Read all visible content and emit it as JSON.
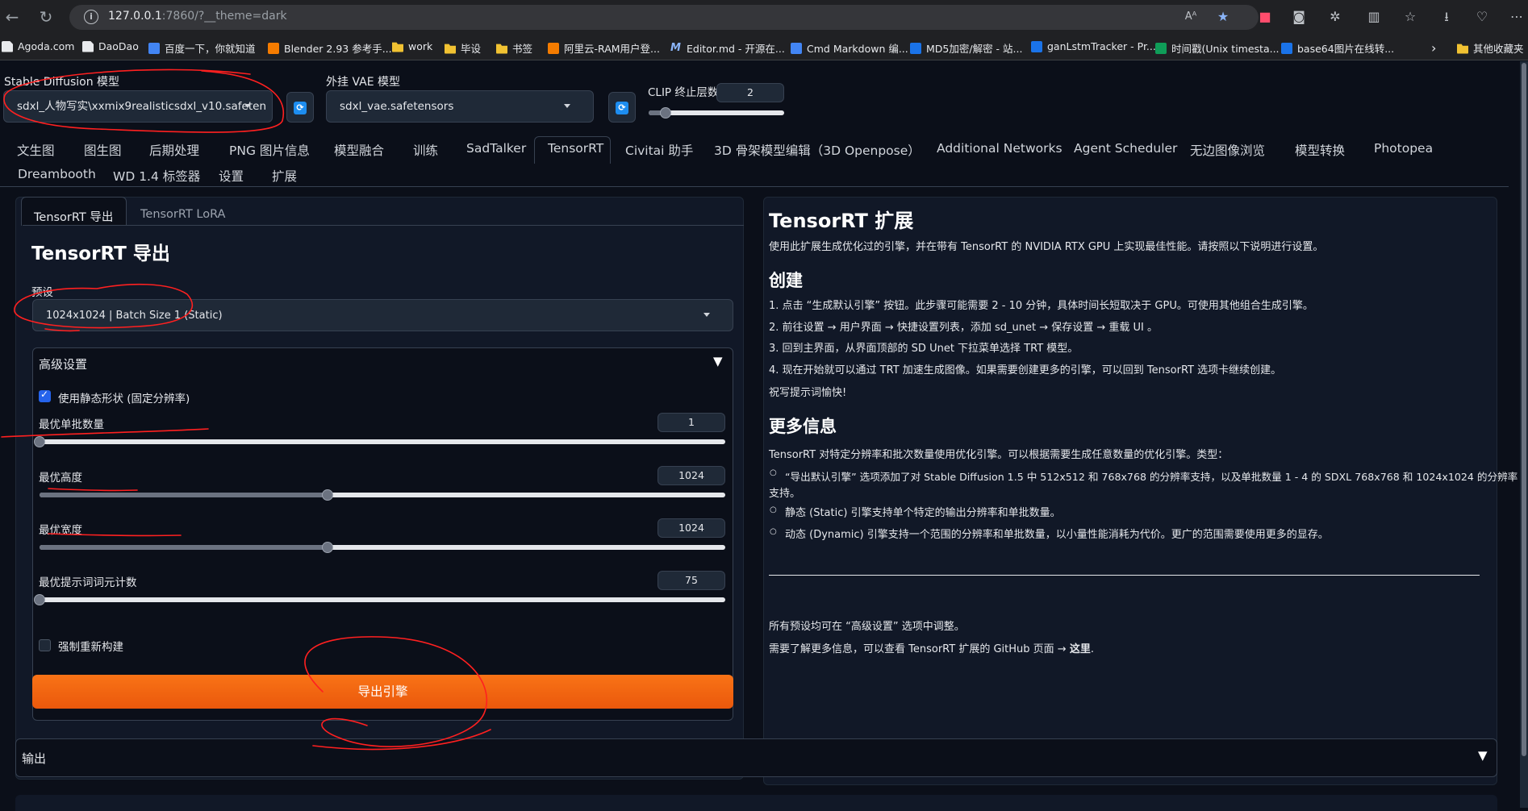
{
  "browser": {
    "url_host": "127.0.0.1",
    "url_rest": ":7860/?__theme=dark",
    "bookmarks": [
      "Agoda.com",
      "DaoDao",
      "百度一下，你就知道",
      "Blender 2.93 参考手...",
      "work",
      "毕设",
      "书签",
      "阿里云-RAM用户登...",
      "Editor.md - 开源在...",
      "Cmd Markdown 编...",
      "MD5加密/解密 - 站...",
      "ganLstmTracker - Pr...",
      "时间戳(Unix timesta...",
      "base64图片在线转...",
      "其他收藏夹"
    ]
  },
  "header": {
    "sd_model_label": "Stable Diffusion 模型",
    "sd_model_value": "sdxl_人物写实\\xxmix9realisticsdxl_v10.safeten",
    "vae_label": "外挂 VAE 模型",
    "vae_value": "sdxl_vae.safetensors",
    "clip_label": "CLIP 终止层数",
    "clip_value": "2"
  },
  "tabs": [
    "文生图",
    "图生图",
    "后期处理",
    "PNG 图片信息",
    "模型融合",
    "训练",
    "SadTalker",
    "TensorRT",
    "Civitai 助手",
    "3D 骨架模型编辑（3D Openpose）",
    "Additional Networks",
    "Agent Scheduler",
    "无边图像浏览",
    "模型转换",
    "Photopea",
    "Dreambooth",
    "WD 1.4 标签器",
    "设置",
    "扩展"
  ],
  "left": {
    "subtabs": [
      "TensorRT 导出",
      "TensorRT LoRA"
    ],
    "title": "TensorRT 导出",
    "preset_label": "预设",
    "preset_value": "1024x1024 | Batch Size 1 (Static)",
    "advanced_label": "高级设置",
    "static_shape_label": "使用静态形状 (固定分辨率)",
    "sliders": [
      {
        "label": "最优单批数量",
        "value": "1",
        "fraction": 0.0
      },
      {
        "label": "最优高度",
        "value": "1024",
        "fraction": 0.42
      },
      {
        "label": "最优宽度",
        "value": "1024",
        "fraction": 0.42
      },
      {
        "label": "最优提示词词元计数",
        "value": "75",
        "fraction": 0.0
      }
    ],
    "force_rebuild_label": "强制重新构建",
    "export_button": "导出引擎"
  },
  "right": {
    "title": "TensorRT 扩展",
    "intro": "使用此扩展生成优化过的引擎，并在带有 TensorRT 的 NVIDIA RTX GPU 上实现最佳性能。请按照以下说明进行设置。",
    "create_heading": "创建",
    "steps": [
      "1. 点击 “生成默认引擎” 按钮。此步骤可能需要 2 - 10 分钟，具体时间长短取决于 GPU。可使用其他组合生成引擎。",
      "2. 前往设置 → 用户界面 → 快捷设置列表，添加 sd_unet → 保存设置 → 重载 UI 。",
      "3. 回到主界面，从界面顶部的 SD Unet 下拉菜单选择 TRT 模型。",
      "4. 现在开始就可以通过 TRT 加速生成图像。如果需要创建更多的引擎，可以回到 TensorRT 选项卡继续创建。"
    ],
    "wish": "祝写提示词愉快!",
    "more_heading": "更多信息",
    "more_intro": "TensorRT 对特定分辨率和批次数量使用优化引擎。可以根据需要生成任意数量的优化引擎。类型：",
    "bullet1_line1": "“导出默认引擎” 选项添加了对 Stable Diffusion 1.5 中 512x512 和 768x768 的分辨率支持，以及单批数量 1 - 4 的 SDXL 768x768 和 1024x1024 的分辨率",
    "bullet1_line2": "支持。",
    "bullet2": "静态 (Static) 引擎支持单个特定的输出分辨率和单批数量。",
    "bullet3": "动态 (Dynamic) 引擎支持一个范围的分辨率和单批数量，以小量性能消耗为代价。更广的范围需要使用更多的显存。",
    "footer1": "所有预设均可在 “高级设置” 选项中调整。",
    "footer2_pre": "需要了解更多信息，可以查看 TensorRT 扩展的 GitHub 页面 → ",
    "footer2_link": "这里",
    "footer2_post": "."
  },
  "output": {
    "label": "输出"
  }
}
